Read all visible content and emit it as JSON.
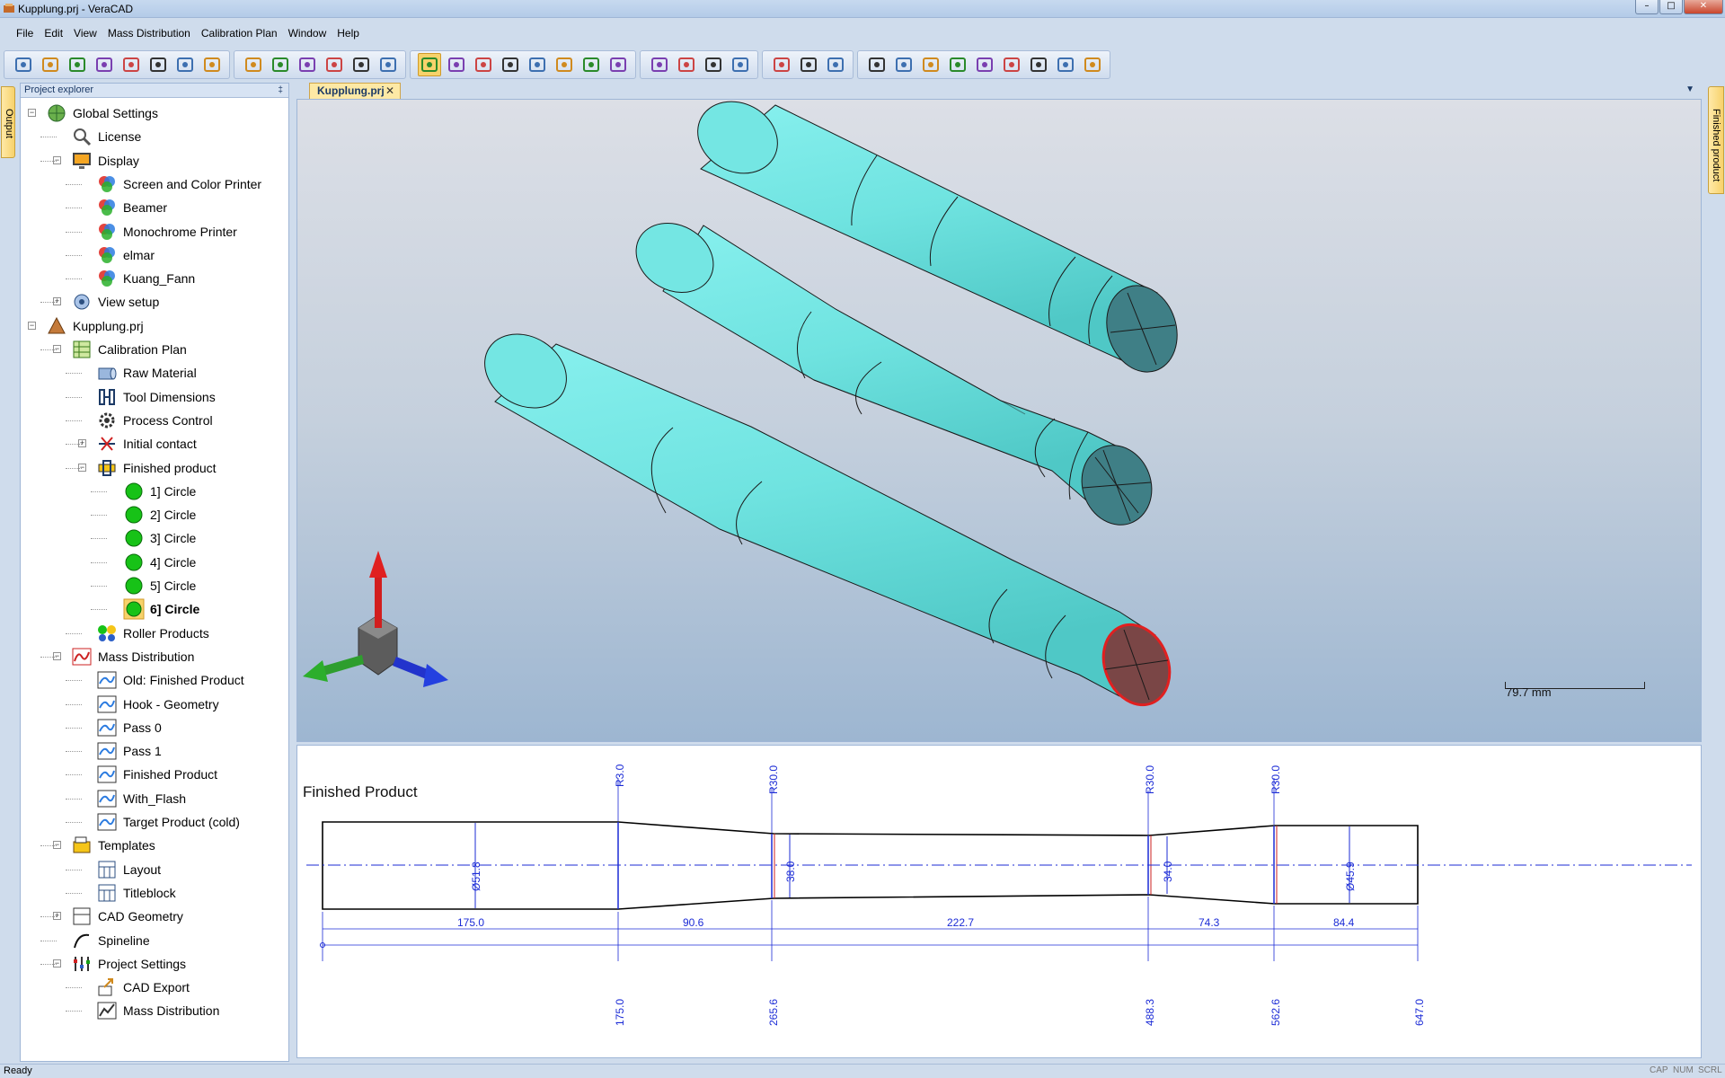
{
  "window": {
    "title": "Kupplung.prj - VeraCAD",
    "min": "–",
    "max": "□",
    "close": "✕"
  },
  "menu": [
    "File",
    "Edit",
    "View",
    "Mass Distribution",
    "Calibration Plan",
    "Window",
    "Help"
  ],
  "toolbar_groups": [
    [
      "new-file-icon",
      "open-folder-icon",
      "save-icon",
      "cut-icon",
      "copy-icon",
      "paste-icon",
      "print-icon",
      "help-icon"
    ],
    [
      "calibration-icon",
      "tool-icon",
      "material-icon",
      "chart-icon",
      "table-icon",
      "cad-icon"
    ],
    [
      "rotate-icon",
      "axes-icon",
      "zoom-in-icon",
      "zoom-out-icon",
      "pan-icon",
      "frame-icon",
      "fit-icon",
      "select-icon"
    ],
    [
      "view-2d-icon",
      "wireframe-icon",
      "solid-icon",
      "warning-icon"
    ],
    [
      "thermometer-icon",
      "eye-icon",
      "measure-icon"
    ],
    [
      "cut-tool-icon",
      "check-tool-icon",
      "visible-icon",
      "duplicate-icon",
      "delete-icon",
      "key-icon",
      "export-icon",
      "import-icon",
      "align-icon"
    ]
  ],
  "side_tabs": {
    "output": "Output",
    "finished_product": "Finished product"
  },
  "explorer": {
    "header": "Project explorer",
    "pin": " ‡",
    "nodes": [
      "Global Settings",
      "License",
      "Display",
      "Screen and Color Printer",
      "Beamer",
      "Monochrome Printer",
      "elmar",
      "Kuang_Fann",
      "View setup",
      "Kupplung.prj",
      "Calibration Plan",
      "Raw Material",
      "Tool Dimensions",
      "Process Control",
      "Initial contact",
      "Finished product",
      "1] Circle",
      "2] Circle",
      "3] Circle",
      "4] Circle",
      "5] Circle",
      "6] Circle",
      "Roller Products",
      "Mass Distribution",
      "Old: Finished Product",
      "Hook - Geometry",
      "Pass 0",
      "Pass 1",
      "Finished Product",
      "With_Flash",
      "Target Product (cold)",
      "Templates",
      "Layout",
      "Titleblock",
      "CAD Geometry",
      "Spineline",
      "Project Settings",
      "CAD Export",
      "Mass Distribution"
    ]
  },
  "document_tab": {
    "label": "Kupplung.prj",
    "close": "✕"
  },
  "viewport": {
    "scale": "79.7 mm"
  },
  "drawing": {
    "title": "Finished Product",
    "radii": [
      "R3.0",
      "R30.0",
      "R30.0",
      "R30.0"
    ],
    "diameters": [
      "Ø51.8",
      "38.0",
      "34.0",
      "Ø45.9"
    ],
    "segment_lengths": [
      "175.0",
      "90.6",
      "222.7",
      "74.3",
      "84.4"
    ],
    "positions": [
      "175.0",
      "265.6",
      "488.3",
      "562.6",
      "647.0"
    ]
  },
  "statusbar": {
    "ready": "Ready",
    "cap": "CAP",
    "num": "NUM",
    "scrl": "SCRL"
  },
  "colors": {
    "tube": "#6fe3e0",
    "end_cap": "#3f7f86",
    "selected_end": "#7a4646",
    "dimension": "#1b2bd6"
  }
}
